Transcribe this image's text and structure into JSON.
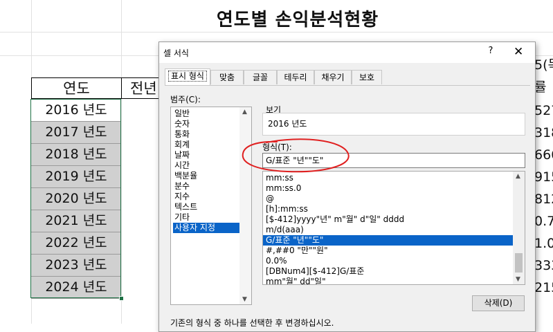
{
  "sheet": {
    "title": "연도별 손익분석현황",
    "col_headers": [
      "연도",
      "전년"
    ],
    "years": [
      "2016 년도",
      "2017 년도",
      "2018 년도",
      "2019 년도",
      "2020 년도",
      "2021 년도",
      "2022 년도",
      "2023 년도",
      "2024 년도"
    ],
    "right_peek": [
      "5(목",
      "률",
      "527",
      "318",
      "666",
      "915",
      "812",
      "0.7",
      "1.0",
      "333",
      "215"
    ]
  },
  "dialog": {
    "title": "셀 서식",
    "help": "?",
    "close": "✕",
    "tabs": [
      "표시 형식",
      "맞춤",
      "글꼴",
      "테두리",
      "채우기",
      "보호"
    ],
    "category_label": "범주(C):",
    "categories": [
      "일반",
      "숫자",
      "통화",
      "회계",
      "날짜",
      "시간",
      "백분율",
      "분수",
      "지수",
      "텍스트",
      "기타",
      "사용자 지정"
    ],
    "selected_category": "사용자 지정",
    "preview_label": "보기",
    "preview_value": "2016 년도",
    "format_label": "형식(T):",
    "format_value": "G/표준 \"년\"\"도\"",
    "format_list": [
      "mm:ss",
      "mm:ss.0",
      "@",
      "[h]:mm:ss",
      "[$-412]yyyy\"년\" m\"월\" d\"일\" dddd",
      "m/d(aaa)",
      "G/표준 \"년\"\"도\"",
      "#,##0 \"만\"\"원\"",
      "0.0%",
      "[DBNum4][$-412]G/표준",
      "mm\"월\" dd\"일\""
    ],
    "selected_format": "G/표준 \"년\"\"도\"",
    "delete_button": "삭제(D)",
    "footer_note": "기존의 형식 중 하나를 선택한 후 변경하십시오."
  },
  "colors": {
    "selection_blue": "#0a64c8",
    "excel_green": "#1e7145",
    "annotation_red": "#e02020",
    "cell_gray": "#d0d0d0"
  }
}
